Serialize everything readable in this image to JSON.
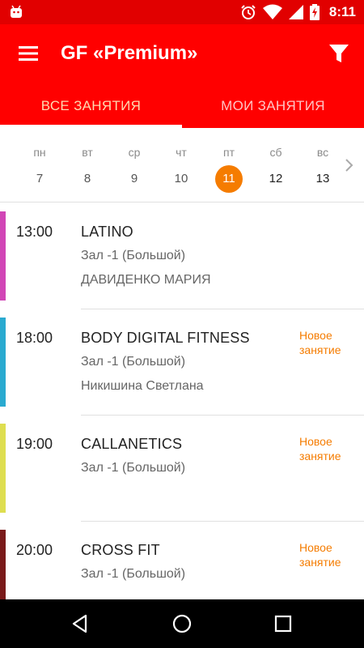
{
  "status_bar": {
    "time": "8:11",
    "icons": [
      "android-icon",
      "alarm-icon",
      "wifi-icon",
      "signal-icon",
      "battery-charging-icon"
    ]
  },
  "app_bar": {
    "title": "GF «Premium»",
    "menu_icon": "menu-icon",
    "filter_icon": "filter-icon"
  },
  "tabs": [
    {
      "label": "ВСЕ ЗАНЯТИЯ",
      "active": true
    },
    {
      "label": "МОИ ЗАНЯТИЯ",
      "active": false
    }
  ],
  "week": {
    "days": [
      {
        "name": "пн",
        "num": "7"
      },
      {
        "name": "вт",
        "num": "8"
      },
      {
        "name": "ср",
        "num": "9"
      },
      {
        "name": "чт",
        "num": "10"
      },
      {
        "name": "пт",
        "num": "11",
        "selected": true
      },
      {
        "name": "сб",
        "num": "12"
      },
      {
        "name": "вс",
        "num": "13"
      }
    ],
    "next_icon": "chevron-right-icon"
  },
  "classes": [
    {
      "time": "13:00",
      "name": "LATINO",
      "hall": "Зал -1 (Большой)",
      "trainer": "ДАВИДЕНКО МАРИЯ",
      "badge": "",
      "color": "#d146b6"
    },
    {
      "time": "18:00",
      "name": "BODY DIGITAL FITNESS",
      "hall": "Зал -1 (Большой)",
      "trainer": "Никишина Светлана",
      "badge": "Новое занятие",
      "color": "#2aaad0"
    },
    {
      "time": "19:00",
      "name": "CALLANETICS",
      "hall": "Зал -1 (Большой)",
      "trainer": "",
      "badge": "Новое занятие",
      "color": "#dede50"
    },
    {
      "time": "20:00",
      "name": "CROSS FIT",
      "hall": "Зал -1 (Большой)",
      "trainer": "",
      "badge": "Новое занятие",
      "color": "#7a1a1a"
    }
  ],
  "nav_bar": {
    "icons": [
      "back-icon",
      "home-icon",
      "recents-icon"
    ]
  },
  "colors": {
    "status_bar": "#e10000",
    "app_bar": "#ff0000",
    "accent": "#f57c00"
  }
}
